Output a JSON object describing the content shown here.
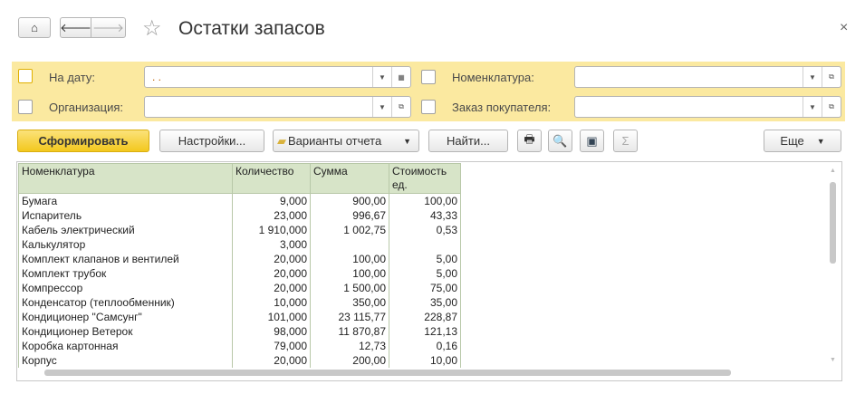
{
  "header": {
    "title": "Остатки запасов",
    "close": "×"
  },
  "filters": [
    {
      "label": "На дату:",
      "value": ". ."
    },
    {
      "label": "Организация:",
      "value": ""
    },
    {
      "label": "Номенклатура:",
      "value": ""
    },
    {
      "label": "Заказ покупателя:",
      "value": ""
    }
  ],
  "toolbar": {
    "generate": "Сформировать",
    "settings": "Настройки...",
    "variants": "Варианты отчета",
    "find": "Найти...",
    "more": "Еще"
  },
  "table": {
    "columns": [
      "Номенклатура",
      "Количество",
      "Сумма",
      "Стоимость ед."
    ],
    "rows": [
      [
        "Бумага",
        "9,000",
        "900,00",
        "100,00"
      ],
      [
        "Испаритель",
        "23,000",
        "996,67",
        "43,33"
      ],
      [
        "Кабель электрический",
        "1 910,000",
        "1 002,75",
        "0,53"
      ],
      [
        "Калькулятор",
        "3,000",
        "",
        ""
      ],
      [
        "Комплект клапанов и вентилей",
        "20,000",
        "100,00",
        "5,00"
      ],
      [
        "Комплект трубок",
        "20,000",
        "100,00",
        "5,00"
      ],
      [
        "Компрессор",
        "20,000",
        "1 500,00",
        "75,00"
      ],
      [
        "Конденсатор (теплообменник)",
        "10,000",
        "350,00",
        "35,00"
      ],
      [
        "Кондиционер \"Самсунг\"",
        "101,000",
        "23 115,77",
        "228,87"
      ],
      [
        "Кондиционер Ветерок",
        "98,000",
        "11 870,87",
        "121,13"
      ],
      [
        "Коробка картонная",
        "79,000",
        "12,73",
        "0,16"
      ],
      [
        "Корпус",
        "20,000",
        "200,00",
        "10,00"
      ]
    ]
  }
}
